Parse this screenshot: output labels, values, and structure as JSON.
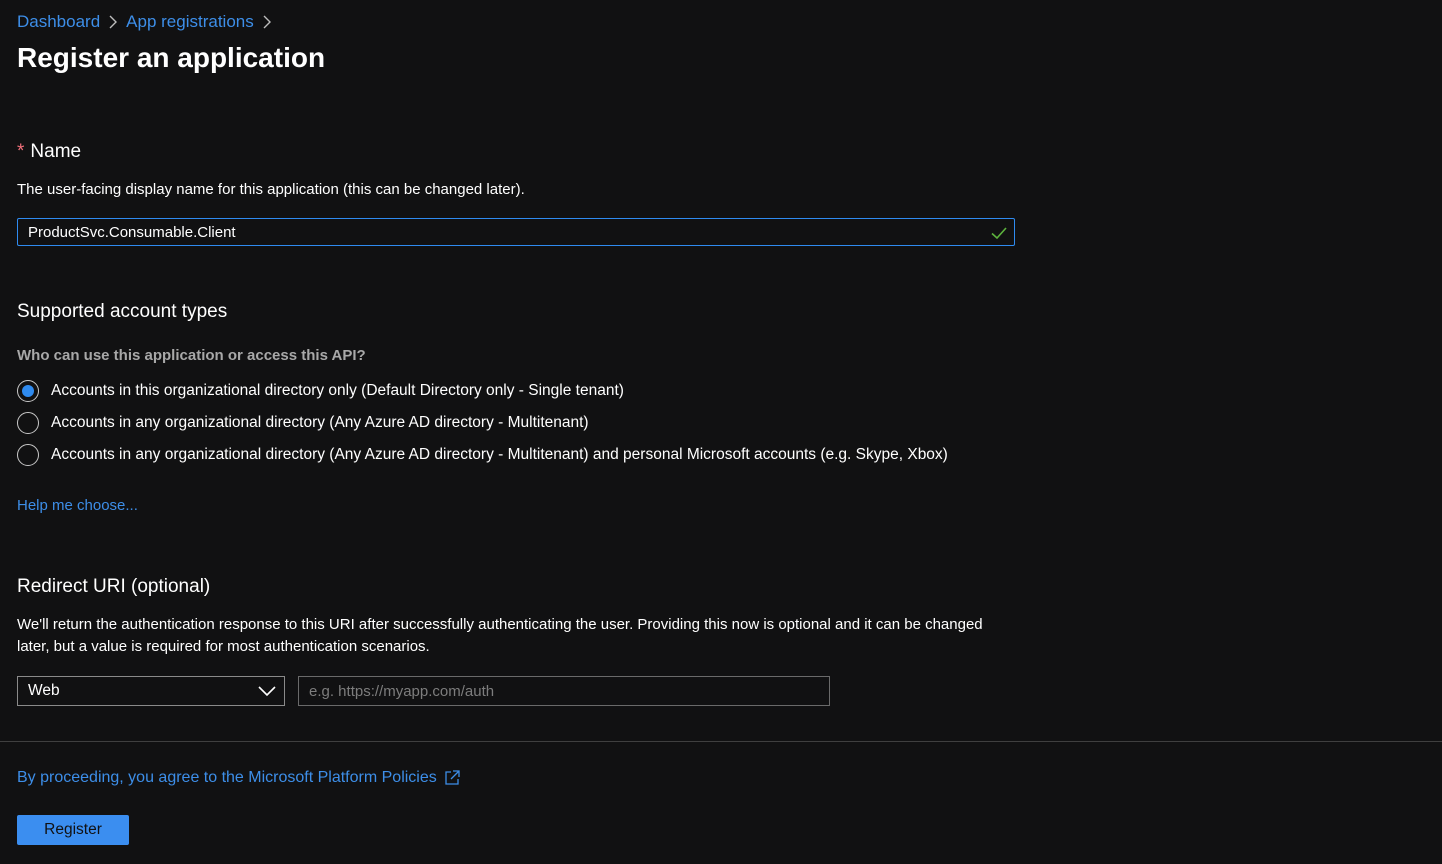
{
  "breadcrumb": {
    "items": [
      {
        "label": "Dashboard"
      },
      {
        "label": "App registrations"
      }
    ]
  },
  "page": {
    "title": "Register an application"
  },
  "name_section": {
    "required_marker": "*",
    "label": "Name",
    "description": "The user-facing display name for this application (this can be changed later).",
    "value": "ProductSvc.Consumable.Client",
    "valid_icon": "checkmark-icon"
  },
  "account_types": {
    "heading": "Supported account types",
    "question": "Who can use this application or access this API?",
    "options": [
      {
        "label": "Accounts in this organizational directory only (Default Directory only - Single tenant)",
        "selected": true
      },
      {
        "label": "Accounts in any organizational directory (Any Azure AD directory - Multitenant)",
        "selected": false
      },
      {
        "label": "Accounts in any organizational directory (Any Azure AD directory - Multitenant) and personal Microsoft accounts (e.g. Skype, Xbox)",
        "selected": false
      }
    ],
    "help_link": "Help me choose..."
  },
  "redirect": {
    "heading": "Redirect URI (optional)",
    "description": "We'll return the authentication response to this URI after successfully authenticating the user. Providing this now is optional and it can be changed later, but a value is required for most authentication scenarios.",
    "platform_selected": "Web",
    "uri_placeholder": "e.g. https://myapp.com/auth",
    "uri_value": ""
  },
  "footer": {
    "policy_text": "By proceeding, you agree to the Microsoft Platform Policies",
    "register_label": "Register"
  },
  "colors": {
    "background": "#111112",
    "accent": "#3b8ef0",
    "link": "#3d8ee8",
    "required": "#f1707b",
    "valid": "#5db33d"
  }
}
